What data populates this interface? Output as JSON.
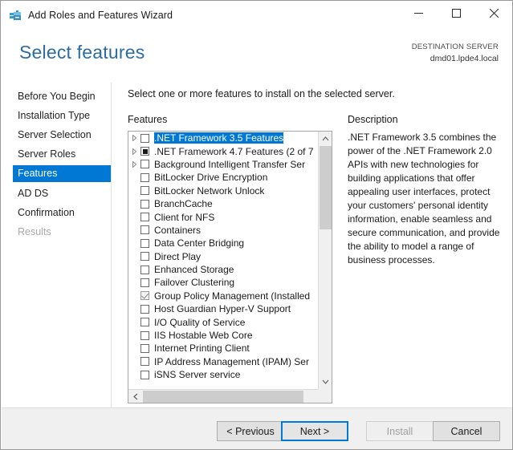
{
  "window": {
    "title": "Add Roles and Features Wizard",
    "icon": "server-wizard-icon",
    "minimize_label": "Minimize",
    "maximize_label": "Maximize",
    "close_label": "Close"
  },
  "header": {
    "page_title": "Select features",
    "destination_label": "DESTINATION SERVER",
    "destination_server": "dmd01.lpde4.local"
  },
  "sidebar": {
    "items": [
      {
        "label": "Before You Begin",
        "state": "normal"
      },
      {
        "label": "Installation Type",
        "state": "normal"
      },
      {
        "label": "Server Selection",
        "state": "normal"
      },
      {
        "label": "Server Roles",
        "state": "normal"
      },
      {
        "label": "Features",
        "state": "selected"
      },
      {
        "label": "AD DS",
        "state": "normal"
      },
      {
        "label": "Confirmation",
        "state": "normal"
      },
      {
        "label": "Results",
        "state": "disabled"
      }
    ]
  },
  "main": {
    "instruction": "Select one or more features to install on the selected server.",
    "features_label": "Features",
    "description_label": "Description",
    "description_text": ".NET Framework 3.5 combines the power of the .NET Framework 2.0 APIs with new technologies for building applications that offer appealing user interfaces, protect your customers' personal identity information, enable seamless and secure communication, and provide the ability to model a range of business processes.",
    "features": [
      {
        "label": ".NET Framework 3.5 Features",
        "checkbox": "unchecked",
        "expandable": true,
        "selected": true
      },
      {
        "label": ".NET Framework 4.7 Features (2 of 7",
        "checkbox": "partial",
        "expandable": true,
        "selected": false
      },
      {
        "label": "Background Intelligent Transfer Ser",
        "checkbox": "unchecked",
        "expandable": true,
        "selected": false
      },
      {
        "label": "BitLocker Drive Encryption",
        "checkbox": "unchecked",
        "expandable": false,
        "selected": false
      },
      {
        "label": "BitLocker Network Unlock",
        "checkbox": "unchecked",
        "expandable": false,
        "selected": false
      },
      {
        "label": "BranchCache",
        "checkbox": "unchecked",
        "expandable": false,
        "selected": false
      },
      {
        "label": "Client for NFS",
        "checkbox": "unchecked",
        "expandable": false,
        "selected": false
      },
      {
        "label": "Containers",
        "checkbox": "unchecked",
        "expandable": false,
        "selected": false
      },
      {
        "label": "Data Center Bridging",
        "checkbox": "unchecked",
        "expandable": false,
        "selected": false
      },
      {
        "label": "Direct Play",
        "checkbox": "unchecked",
        "expandable": false,
        "selected": false
      },
      {
        "label": "Enhanced Storage",
        "checkbox": "unchecked",
        "expandable": false,
        "selected": false
      },
      {
        "label": "Failover Clustering",
        "checkbox": "unchecked",
        "expandable": false,
        "selected": false
      },
      {
        "label": "Group Policy Management (Installed",
        "checkbox": "installed",
        "expandable": false,
        "selected": false
      },
      {
        "label": "Host Guardian Hyper-V Support",
        "checkbox": "unchecked",
        "expandable": false,
        "selected": false
      },
      {
        "label": "I/O Quality of Service",
        "checkbox": "unchecked",
        "expandable": false,
        "selected": false
      },
      {
        "label": "IIS Hostable Web Core",
        "checkbox": "unchecked",
        "expandable": false,
        "selected": false
      },
      {
        "label": "Internet Printing Client",
        "checkbox": "unchecked",
        "expandable": false,
        "selected": false
      },
      {
        "label": "IP Address Management (IPAM) Ser",
        "checkbox": "unchecked",
        "expandable": false,
        "selected": false
      },
      {
        "label": "iSNS Server service",
        "checkbox": "unchecked",
        "expandable": false,
        "selected": false
      }
    ]
  },
  "footer": {
    "previous_label": "< Previous",
    "next_label": "Next >",
    "install_label": "Install",
    "cancel_label": "Cancel"
  },
  "colors": {
    "accent": "#0078d4",
    "title_blue": "#2c6ca3",
    "footer_bg": "#f0f0f0"
  }
}
